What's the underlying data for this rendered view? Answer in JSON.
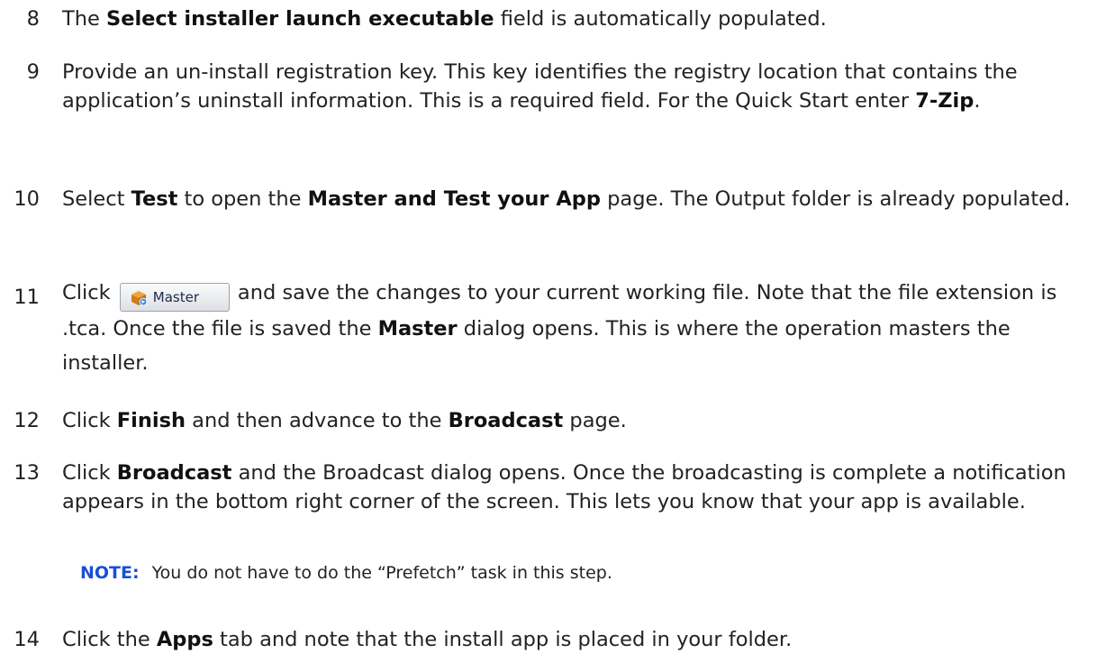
{
  "steps": [
    {
      "number": "8",
      "parts": {
        "a": "The ",
        "b": "Select installer launch executable",
        "c": " field is automatically populated."
      }
    },
    {
      "number": "9",
      "parts": {
        "a": "Provide an un-install registration key. This key identifies the registry location that contains the application’s uninstall information. This is a required field. For the Quick Start enter ",
        "b": "7-Zip",
        "c": "."
      }
    },
    {
      "number": "10",
      "parts": {
        "a": "Select ",
        "b": "Test",
        "c": " to open the ",
        "d": "Master and Test your App",
        "e": " page. The Output folder is already populated."
      }
    },
    {
      "number": "11",
      "parts": {
        "a": "Click ",
        "button_label": "Master",
        "c": " and save the changes to your current working file. Note that the file extension is .tca. Once the file is saved the ",
        "d": "Master",
        "e": " dialog opens. This is  where the operation masters the installer."
      }
    },
    {
      "number": "12",
      "parts": {
        "a": " Click ",
        "b": "Finish",
        "c": " and then advance to the ",
        "d": "Broadcast",
        "e": " page."
      }
    },
    {
      "number": "13",
      "parts": {
        "a": "Click ",
        "b": "Broadcast",
        "c": " and the Broadcast dialog opens. Once the broadcasting is complete a notification appears in the bottom right corner of the screen. This lets you know that your app is available."
      }
    },
    {
      "number": "14",
      "parts": {
        "a": "Click the ",
        "b": "Apps",
        "c": " tab and note that the install app is placed in your folder."
      }
    }
  ],
  "note": {
    "label": "NOTE:",
    "text": "You do not have to do the “Prefetch” task in this step.",
    "label_color": "#1a4fd6"
  },
  "master_button": {
    "icon": "package-icon"
  }
}
